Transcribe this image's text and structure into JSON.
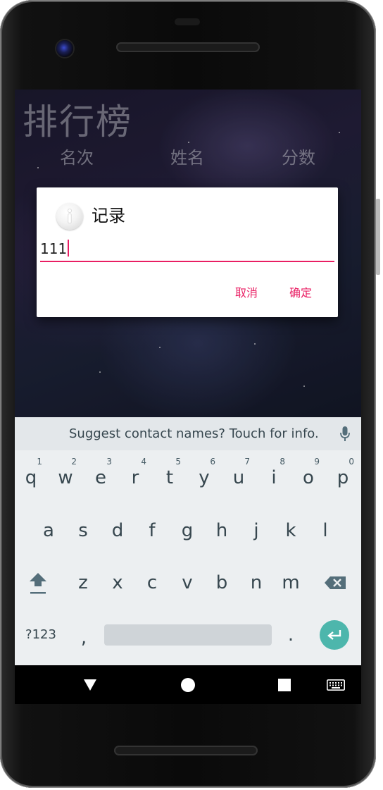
{
  "app": {
    "title": "排行榜",
    "columns": [
      "名次",
      "姓名",
      "分数"
    ]
  },
  "dialog": {
    "title": "记录",
    "input_value": "111",
    "cancel_label": "取消",
    "confirm_label": "确定",
    "accent_color": "#e91e63"
  },
  "keyboard": {
    "suggestion": "Suggest contact names? Touch for info.",
    "row1": [
      {
        "key": "q",
        "hint": "1"
      },
      {
        "key": "w",
        "hint": "2"
      },
      {
        "key": "e",
        "hint": "3"
      },
      {
        "key": "r",
        "hint": "4"
      },
      {
        "key": "t",
        "hint": "5"
      },
      {
        "key": "y",
        "hint": "6"
      },
      {
        "key": "u",
        "hint": "7"
      },
      {
        "key": "i",
        "hint": "8"
      },
      {
        "key": "o",
        "hint": "9"
      },
      {
        "key": "p",
        "hint": "0"
      }
    ],
    "row2": [
      "a",
      "s",
      "d",
      "f",
      "g",
      "h",
      "j",
      "k",
      "l"
    ],
    "row3": [
      "z",
      "x",
      "c",
      "v",
      "b",
      "n",
      "m"
    ],
    "symbols_label": "?123",
    "comma": ",",
    "period": ".",
    "enter_color": "#4db6ac"
  },
  "icons": {
    "dialog_icon": "info-icon",
    "shift": "shift-icon",
    "backspace": "backspace-icon",
    "mic": "mic-icon",
    "enter": "enter-icon",
    "nav_back": "back-triangle-icon",
    "nav_home": "home-circle-icon",
    "nav_recents": "recents-square-icon",
    "nav_keyboard": "keyboard-icon"
  }
}
